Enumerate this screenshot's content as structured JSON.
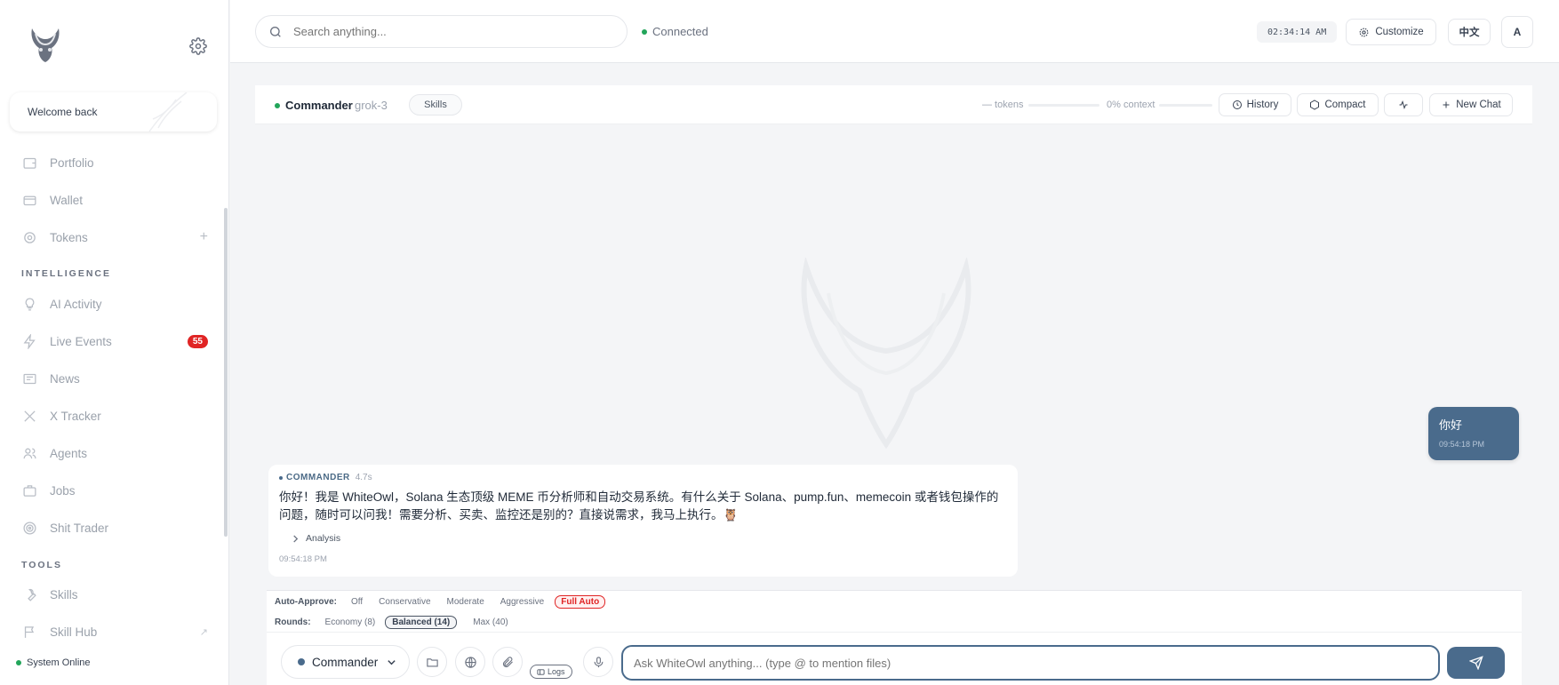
{
  "sidebar": {
    "welcome": "Welcome back",
    "items_top": [
      {
        "label": "Portfolio",
        "icon": "portfolio-icon"
      },
      {
        "label": "Wallet",
        "icon": "wallet-icon"
      },
      {
        "label": "Tokens",
        "icon": "tokens-icon"
      }
    ],
    "section_intelligence": "INTELLIGENCE",
    "items_intel": [
      {
        "label": "AI Activity",
        "icon": "bulb-icon"
      },
      {
        "label": "Live Events",
        "icon": "bolt-icon",
        "badge": "55"
      },
      {
        "label": "News",
        "icon": "news-icon"
      },
      {
        "label": "X Tracker",
        "icon": "x-icon"
      },
      {
        "label": "Agents",
        "icon": "users-icon"
      },
      {
        "label": "Jobs",
        "icon": "briefcase-icon"
      },
      {
        "label": "Shit Trader",
        "icon": "target-icon"
      }
    ],
    "section_tools": "TOOLS",
    "items_tools": [
      {
        "label": "Skills",
        "icon": "wrench-icon"
      },
      {
        "label": "Skill Hub",
        "icon": "flag-icon"
      }
    ],
    "system_status": "System Online"
  },
  "topbar": {
    "search_placeholder": "Search anything...",
    "connection": "Connected",
    "clock": "02:34:14 AM",
    "customize": "Customize",
    "language": "中文",
    "avatar": "A"
  },
  "chat_header": {
    "agent": "Commander",
    "separator": "·",
    "model": "grok-3",
    "skills": "Skills",
    "tokens": "— tokens",
    "context": "0% context",
    "history": "History",
    "compact": "Compact",
    "new_chat": "New Chat"
  },
  "messages": {
    "user": {
      "text": "你好",
      "time": "09:54:18 PM"
    },
    "bot": {
      "sender": "COMMANDER",
      "duration": "4.7s",
      "text": "你好！我是 WhiteOwl，Solana 生态顶级 MEME 币分析师和自动交易系统。有什么关于 Solana、pump.fun、memecoin 或者钱包操作的问题，随时可以问我！需要分析、买卖、监控还是别的？直接说需求，我马上执行。🦉",
      "analysis": "Analysis",
      "time": "09:54:18 PM"
    }
  },
  "composer": {
    "auto_approve_label": "Auto-Approve:",
    "auto_approve_options": [
      "Off",
      "Conservative",
      "Moderate",
      "Aggressive",
      "Full Auto"
    ],
    "auto_approve_selected": "Full Auto",
    "rounds_label": "Rounds:",
    "rounds_options": [
      "Economy (8)",
      "Balanced (14)",
      "Max (40)"
    ],
    "rounds_selected": "Balanced (14)",
    "agent": "Commander",
    "logs": "Logs",
    "input_placeholder": "Ask WhiteOwl anything... (type @ to mention files)"
  },
  "colors": {
    "accent": "#4a6b8c",
    "online": "#22a55a",
    "danger": "#e02424"
  }
}
